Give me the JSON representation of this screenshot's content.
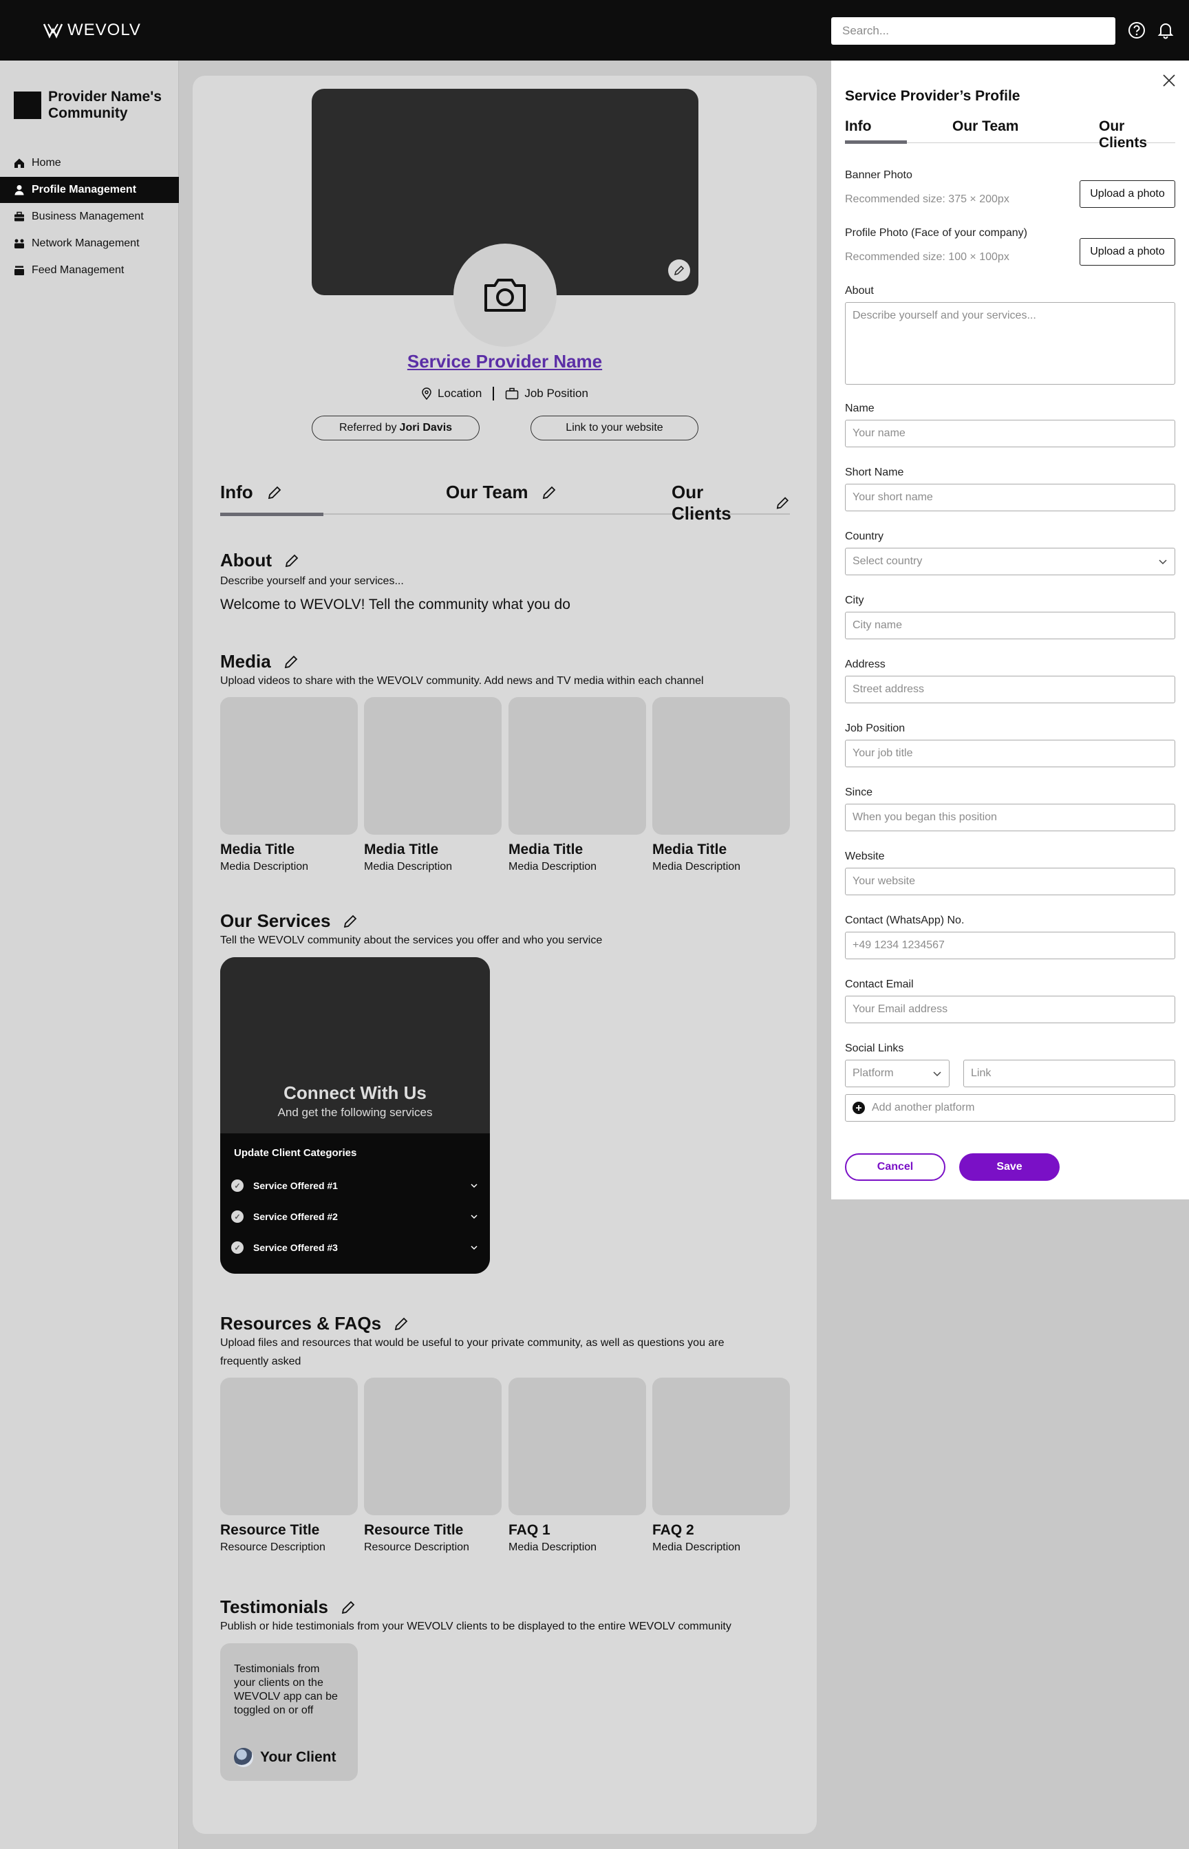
{
  "app": {
    "brand": "WEVOLV",
    "brand_color": "#7a10c6"
  },
  "header": {
    "search_placeholder": "Search...",
    "help_icon": "help-circle-icon",
    "bell_icon": "bell-icon"
  },
  "sidebar": {
    "community_name": "Provider Name's Community",
    "items": [
      {
        "label": "Home",
        "icon": "home-icon",
        "active": false
      },
      {
        "label": "Profile Management",
        "icon": "person-icon",
        "active": true
      },
      {
        "label": "Business Management",
        "icon": "briefcase-icon",
        "active": false
      },
      {
        "label": "Network Management",
        "icon": "network-icon",
        "active": false
      },
      {
        "label": "Feed Management",
        "icon": "feed-icon",
        "active": false
      }
    ]
  },
  "profile": {
    "name": "Service Provider Name",
    "location": "Location",
    "job_position": "Job Position",
    "referred_prefix": "Referred by",
    "referred_name": "Jori Davis",
    "website_link": "Link to your website"
  },
  "tabs": [
    "Info",
    "Our Team",
    "Our Clients"
  ],
  "about": {
    "title": "About",
    "desc": "Describe yourself and your services...",
    "text": "Welcome to WEVOLV! Tell the community what you do"
  },
  "media": {
    "title": "Media",
    "desc": "Upload videos to share with the WEVOLV community. Add news and TV media within each channel",
    "items": [
      {
        "title": "Media Title",
        "desc": "Media Description"
      },
      {
        "title": "Media Title",
        "desc": "Media Description"
      },
      {
        "title": "Media Title",
        "desc": "Media Description"
      },
      {
        "title": "Media Title",
        "desc": "Media Description"
      }
    ]
  },
  "services": {
    "title": "Our Services",
    "desc": "Tell the WEVOLV community about the services you offer and who you service",
    "card_title": "Connect With Us",
    "card_sub": "And get the following services",
    "update_label": "Update Client Categories",
    "items": [
      "Service Offered #1",
      "Service Offered #2",
      "Service Offered #3"
    ]
  },
  "resources": {
    "title": "Resources & FAQs",
    "desc": "Upload files and resources that would be useful to your private community, as well as questions you are frequently asked",
    "items": [
      {
        "title": "Resource Title",
        "desc": "Resource Description"
      },
      {
        "title": "Resource Title",
        "desc": "Resource Description"
      },
      {
        "title": "FAQ 1",
        "desc": "Media Description"
      },
      {
        "title": "FAQ 2",
        "desc": "Media Description"
      }
    ]
  },
  "testimonials": {
    "title": "Testimonials",
    "desc": "Publish or hide testimonials from your WEVOLV clients to be displayed to the entire WEVOLV community",
    "card_text": "Testimonials from your clients on the WEVOLV app can be toggled on or off",
    "client": "Your Client"
  },
  "panel": {
    "title": "Service Provider’s Profile",
    "tabs": [
      "Info",
      "Our Team",
      "Our Clients"
    ],
    "banner_label": "Banner Photo",
    "banner_hint": "Recommended size: 375 × 200px",
    "upload_label": "Upload a photo",
    "profile_photo_label": "Profile Photo (Face of your company)",
    "profile_photo_hint": "Recommended size: 100 × 100px",
    "about_label": "About",
    "about_placeholder": "Describe yourself and your services...",
    "fields": [
      {
        "label": "Name",
        "placeholder": "Your name"
      },
      {
        "label": "Short Name",
        "placeholder": "Your short name"
      },
      {
        "label": "Country",
        "placeholder": "Select country"
      },
      {
        "label": "City",
        "placeholder": "City name"
      },
      {
        "label": "Address",
        "placeholder": "Street address"
      },
      {
        "label": "Job Position",
        "placeholder": "Your job title"
      },
      {
        "label": "Since",
        "placeholder": "When you began this position"
      },
      {
        "label": "Website",
        "placeholder": "Your website"
      },
      {
        "label": "Contact (WhatsApp) No.",
        "placeholder": "+49 1234 1234567"
      },
      {
        "label": "Contact Email",
        "placeholder": "Your Email address"
      }
    ],
    "social_label": "Social Links",
    "platform_placeholder": "Platform",
    "link_placeholder": "Link",
    "add_platform": "Add another platform",
    "cancel": "Cancel",
    "save": "Save"
  }
}
